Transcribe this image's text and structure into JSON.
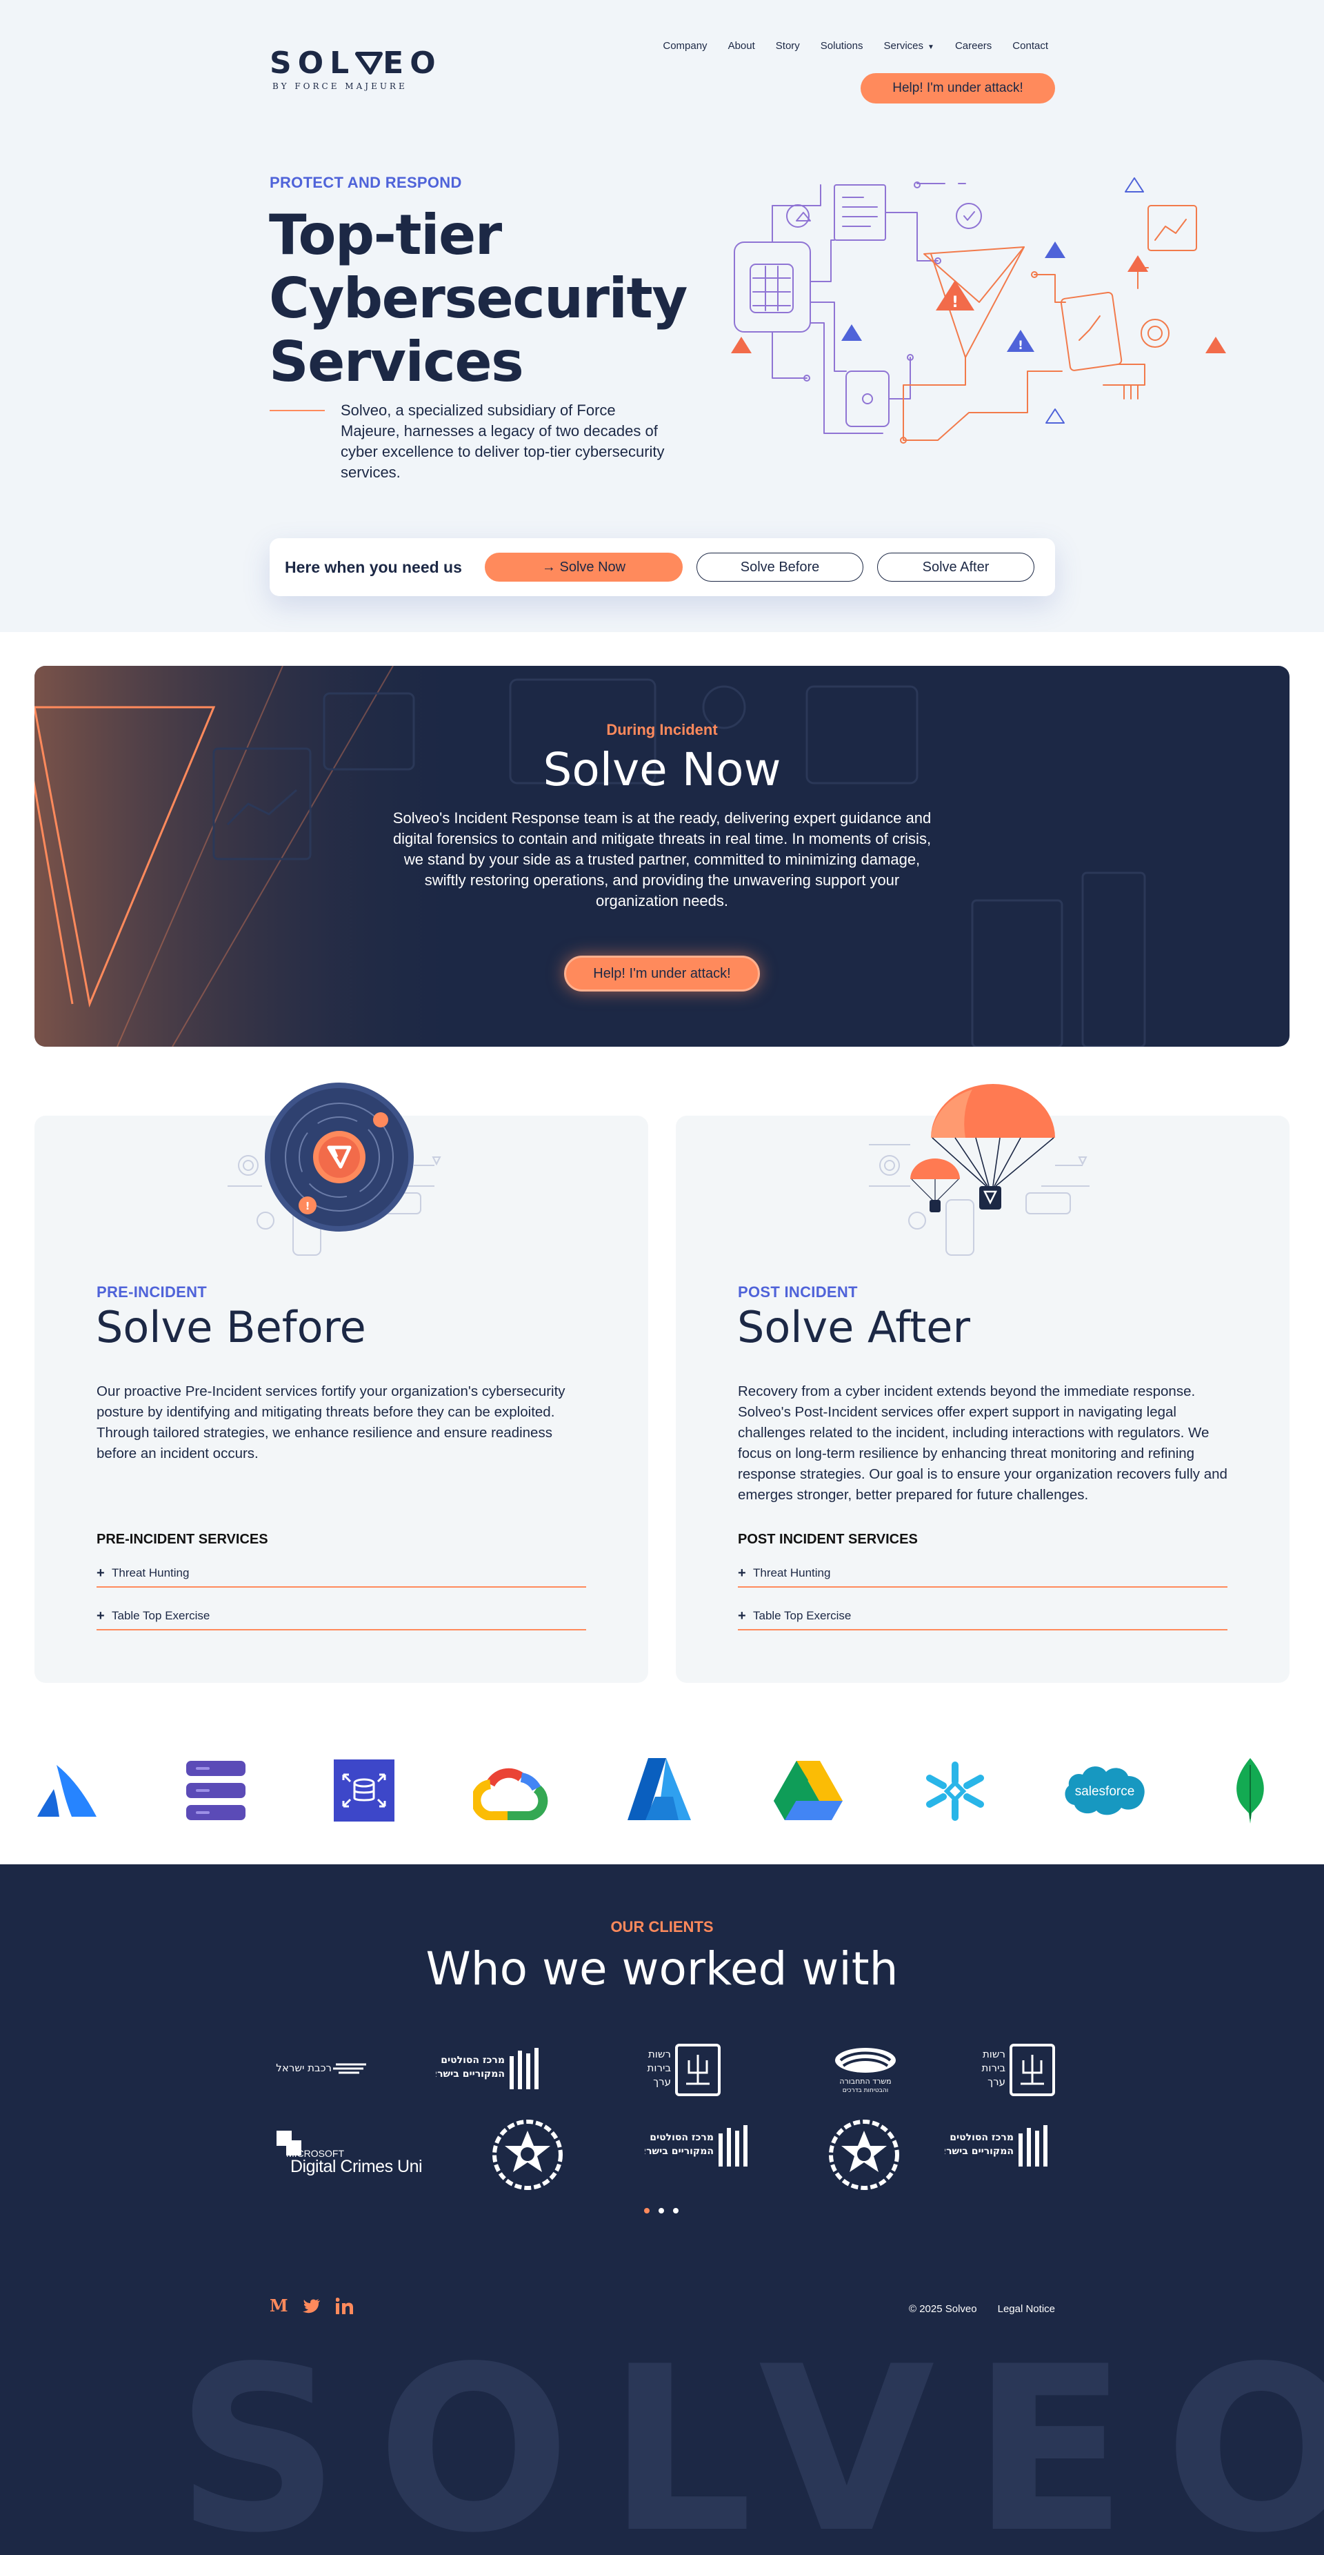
{
  "brand": {
    "name": "SOLVEO",
    "tagline": "BY FORCE MAJEURE",
    "accent": "#ff8a5c",
    "navy": "#1c2845",
    "blue": "#4f63d9"
  },
  "nav": {
    "items": [
      "Company",
      "About",
      "Story",
      "Solutions",
      "Services",
      "Careers",
      "Contact"
    ],
    "attack_button": "Help! I'm under attack!"
  },
  "hero": {
    "eyebrow": "PROTECT AND RESPOND",
    "title_line1": "Top-tier",
    "title_line2": "Cybersecurity",
    "title_line3": "Services",
    "description": "Solveo, a specialized subsidiary of Force Majeure, harnesses a legacy of two decades of cyber excellence to deliver top-tier cybersecurity services."
  },
  "help_bar": {
    "label": "Here when you need us",
    "solve_now": "→ Solve Now",
    "solve_before": "Solve Before",
    "solve_after": "Solve After"
  },
  "solve_now": {
    "eyebrow": "During Incident",
    "title": "Solve Now",
    "description": "Solveo's Incident Response team is at the ready, delivering expert guidance and digital forensics to contain and mitigate threats in real time. In moments of crisis, we stand by your side as a trusted partner, committed to minimizing damage, swiftly restoring operations, and providing the unwavering support your organization needs.",
    "button": "Help! I'm under attack!"
  },
  "solve_before": {
    "eyebrow": "PRE-INCIDENT",
    "title": "Solve Before",
    "description": "Our proactive Pre-Incident services fortify your organization's cybersecurity posture by identifying and mitigating threats before they can be exploited. Through tailored strategies, we enhance resilience and ensure readiness before an incident occurs.",
    "services_title": "PRE-INCIDENT SERVICES",
    "services": [
      "Threat Hunting",
      "Table Top Exercise"
    ]
  },
  "solve_after": {
    "eyebrow": "POST INCIDENT",
    "title": "Solve After",
    "description": "Recovery from a cyber incident extends beyond the immediate response. Solveo's Post-Incident services offer expert support in navigating legal challenges related to the incident, including interactions with regulators. We focus on long-term resilience by enhancing threat monitoring and refining response strategies. Our goal is to ensure your organization recovers fully and emerges stronger, better prepared for future challenges.",
    "services_title": "POST INCIDENT SERVICES",
    "services": [
      "Threat Hunting",
      "Table Top Exercise"
    ]
  },
  "partners": {
    "icons": [
      "atlassian-icon",
      "stack-icon",
      "database-icon",
      "google-cloud-icon",
      "azure-icon",
      "google-drive-icon",
      "snowflake-icon",
      "salesforce-icon",
      "mongodb-icon"
    ],
    "salesforce_label": "salesforce"
  },
  "clients": {
    "eyebrow": "OUR CLIENTS",
    "title": "Who we worked with",
    "israel_railways": "רכבת ישראל",
    "cyber_center": "מרכז הסולטים",
    "cyber_center_sub": "המקוריים בישראל",
    "city_authority": "רשות",
    "city_authority_line2": "בירות",
    "city_authority_line3": "ערך",
    "ministry_label": "משרד התחבורה",
    "ministry_sub": "והבטיחות בדרכים",
    "microsoft_top": "MICROSOFT",
    "microsoft_bottom": "Digital Crimes Unit",
    "carousel_pages": 3,
    "carousel_active": 1
  },
  "footer": {
    "copyright": "© 2025 Solveo",
    "legal": "Legal Notice",
    "social": [
      "medium-icon",
      "twitter-icon",
      "linkedin-icon"
    ],
    "big_word": "SOLVEO"
  }
}
